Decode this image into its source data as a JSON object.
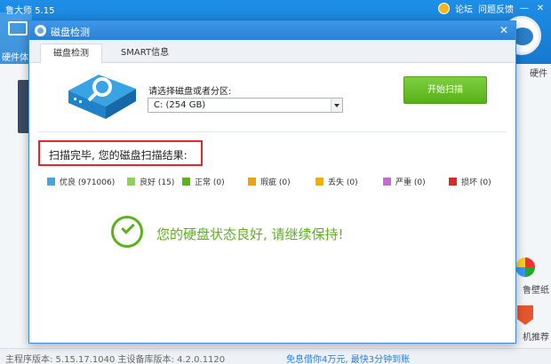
{
  "app": {
    "title": "鲁大师 5.15",
    "forum": "论坛",
    "feedback": "问题反馈",
    "tab_hardware": "硬件体",
    "right_label_1": "硬件",
    "right_label_2": "鲁壁纸",
    "right_label_3": "机推荐"
  },
  "status": {
    "left": "主程序版本: 5.15.17.1040   主设备库版本: 4.2.0.1120",
    "center": "免息借你4万元, 最快3分钟到账"
  },
  "dialog": {
    "title": "磁盘检测",
    "tabs": [
      "磁盘检测",
      "SMART信息"
    ],
    "select_label": "请选择磁盘或者分区:",
    "selected_disk": "C:  (254 GB)",
    "scan_button": "开始扫描",
    "result_text": "扫描完毕, 您的磁盘扫描结果:",
    "legend": [
      {
        "label": "优良 (971006)",
        "color": "#4aa3df"
      },
      {
        "label": "良好 (15)",
        "color": "#8fd15a"
      },
      {
        "label": "正常 (0)",
        "color": "#5cb21c"
      },
      {
        "label": "瑕疵 (0)",
        "color": "#e8a317"
      },
      {
        "label": "丢失 (0)",
        "color": "#f0b000"
      },
      {
        "label": "严重 (0)",
        "color": "#c66ad1"
      },
      {
        "label": "损坏 (0)",
        "color": "#d42a2a"
      }
    ],
    "ok_message": "您的硬盘状态良好, 请继续保持!"
  }
}
